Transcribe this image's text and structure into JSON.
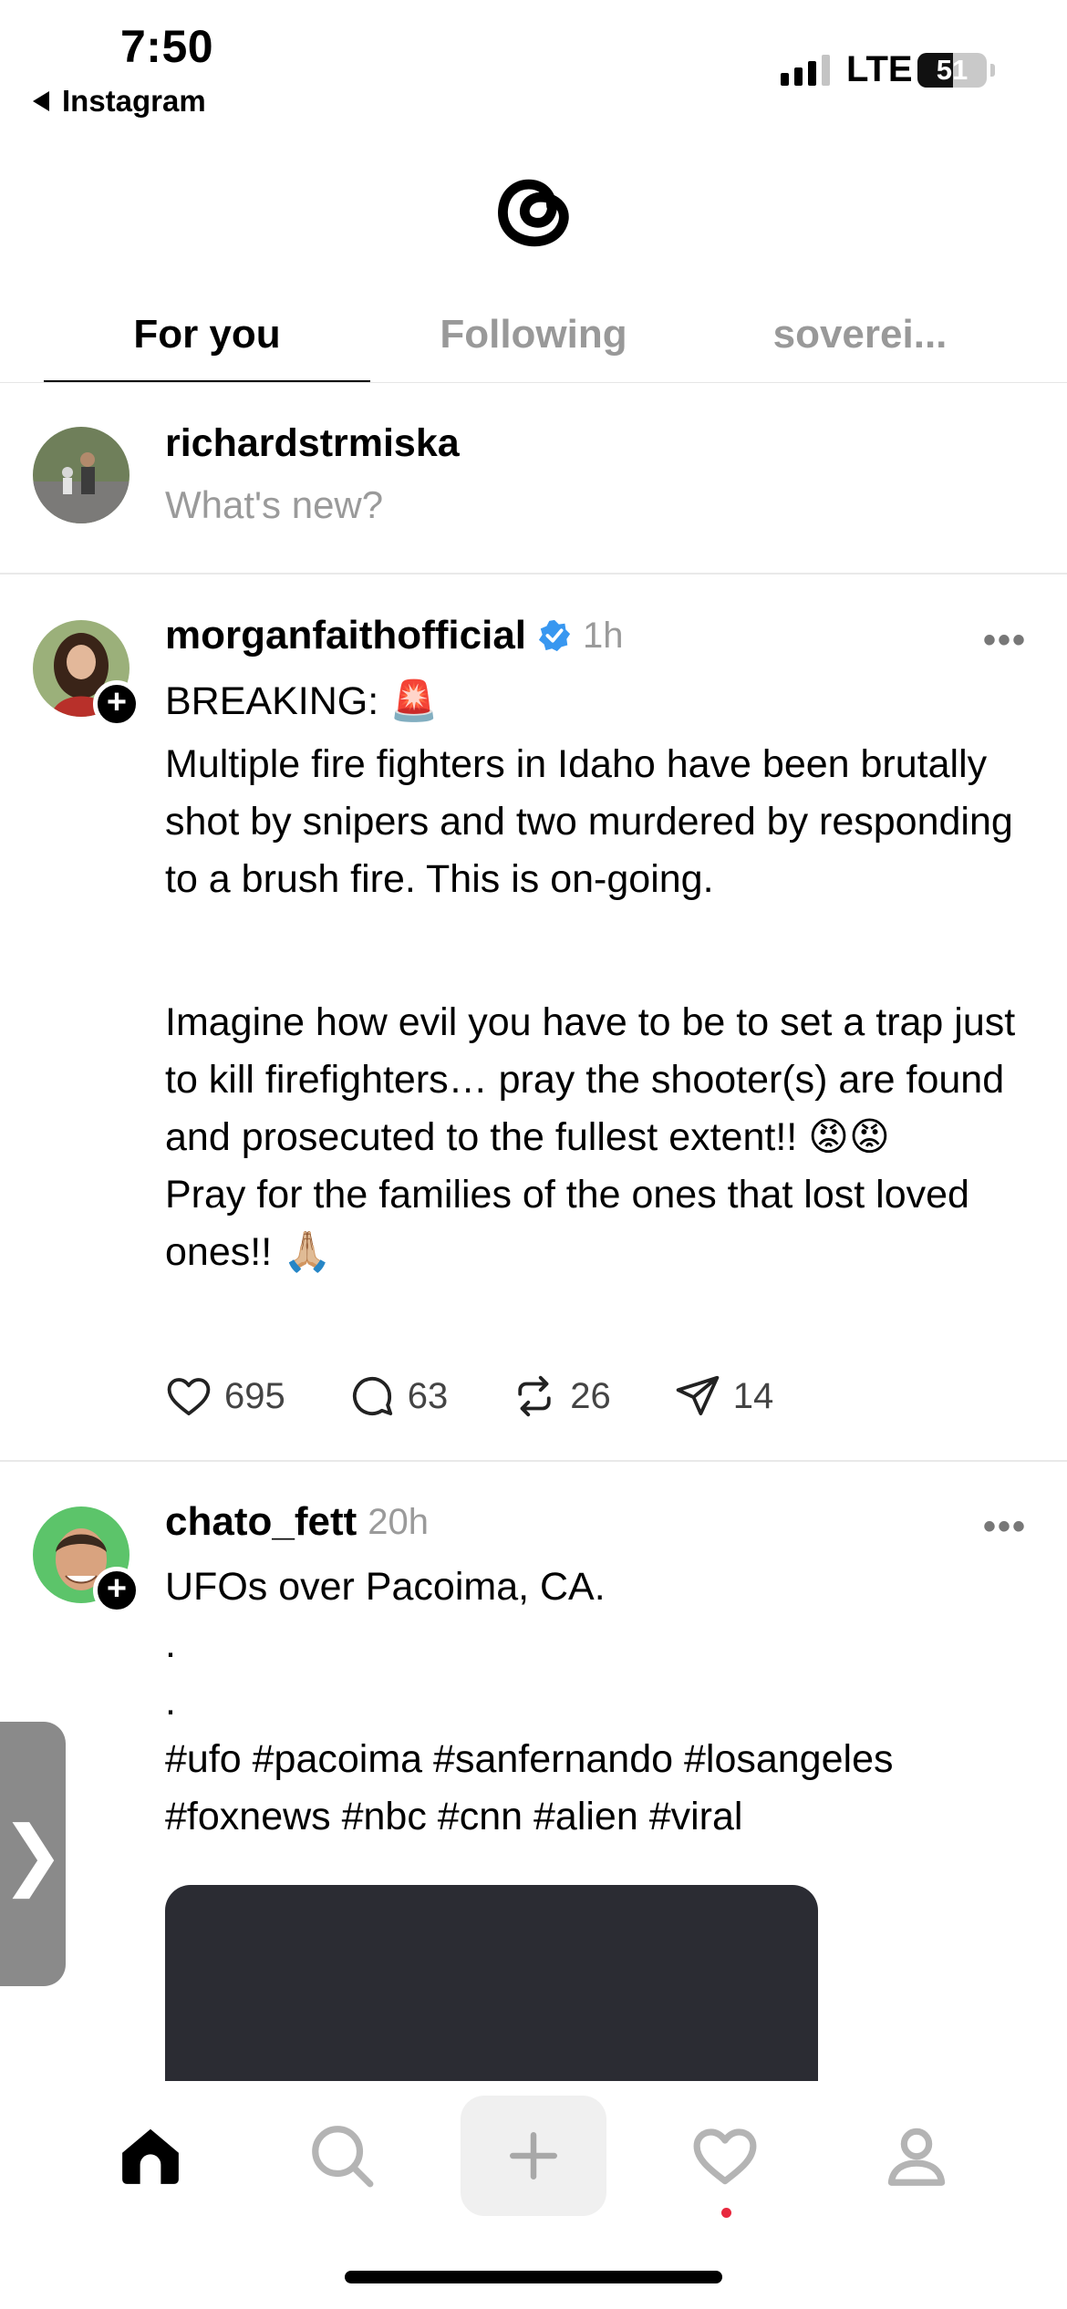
{
  "status_bar": {
    "time": "7:50",
    "back_app": "Instagram",
    "network": "LTE",
    "battery_level": "51"
  },
  "tabs": [
    {
      "label": "For you",
      "active": true
    },
    {
      "label": "Following",
      "active": false
    },
    {
      "label": "soverei...",
      "active": false
    }
  ],
  "composer": {
    "username": "richardstrmiska",
    "placeholder": "What's new?"
  },
  "posts": [
    {
      "username": "morganfaithofficial",
      "verified": true,
      "time": "1h",
      "more": "•••",
      "line1": "BREAKING: 🚨",
      "para1": "Multiple fire fighters in Idaho have been brutally shot by snipers and two murdered by responding to a brush fire. This is on-going.",
      "para2": "Imagine how evil you have to be to set a trap just to kill firefighters… pray the shooter(s) are found and prosecuted to the fullest extent!! 😡😡\nPray for the families of the ones that lost loved ones!! 🙏🏼",
      "likes": "695",
      "replies": "63",
      "reposts": "26",
      "shares": "14"
    },
    {
      "username": "chato_fett",
      "time": "20h",
      "more": "•••",
      "text": "UFOs over Pacoima, CA.\n.\n.\n#ufo #pacoima #sanfernando #losangeles #foxnews #nbc #cnn #alien #viral"
    }
  ],
  "side_handle": "❯",
  "nav": [
    "home-icon",
    "search-icon",
    "create-icon",
    "activity-icon",
    "profile-icon"
  ],
  "colors": {
    "verified": "#3897f0",
    "notification": "#e8283e",
    "muted": "#9a9a9a"
  }
}
